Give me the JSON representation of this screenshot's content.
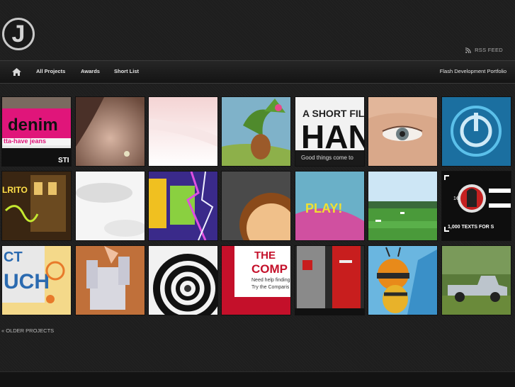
{
  "logo": {
    "letter": "J"
  },
  "rss": {
    "label": "RSS FEED",
    "icon": "rss-icon"
  },
  "nav": {
    "home_icon": "home-icon",
    "links": [
      "All Projects",
      "Awards",
      "Short List"
    ],
    "tagline": "Flash Development Portfolio"
  },
  "tiles": {
    "denim": {
      "headline": "denim",
      "subline": "tta-have jeans",
      "badge": "STI"
    },
    "short_film": {
      "line1": "A SHORT FIL",
      "line2": "HAN",
      "line3": "Good things come to"
    },
    "rito": {
      "text": "LRITO"
    },
    "play": {
      "text": "PLAY!"
    },
    "lincoln": {
      "text": "1,000 TEXTS FOR S",
      "badge": "1¢"
    },
    "touch": {
      "line1": "CT",
      "line2": "UCH"
    },
    "compare": {
      "line1": "THE",
      "line2": "COMP",
      "line3": "Need help finding",
      "line4": "Try the Comparis"
    }
  },
  "older_link": "« OLDER PROJECTS"
}
